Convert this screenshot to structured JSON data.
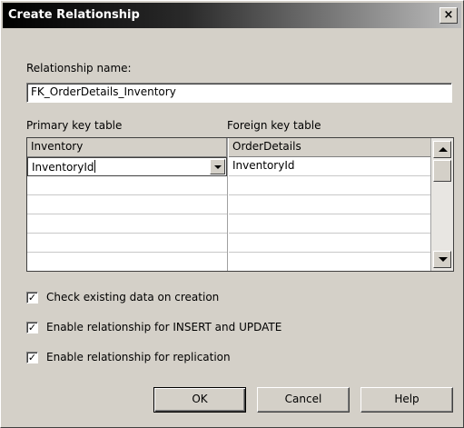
{
  "window": {
    "title": "Create Relationship",
    "close_label": "×"
  },
  "relationship_name": {
    "label": "Relationship name:",
    "value": "FK_OrderDetails_Inventory"
  },
  "grid": {
    "primary_label": "Primary key table",
    "foreign_label": "Foreign key table",
    "primary_table": "Inventory",
    "foreign_table": "OrderDetails",
    "rows": [
      {
        "primary": "InventoryId",
        "foreign": "InventoryId"
      },
      {
        "primary": "",
        "foreign": ""
      },
      {
        "primary": "",
        "foreign": ""
      },
      {
        "primary": "",
        "foreign": ""
      },
      {
        "primary": "",
        "foreign": ""
      },
      {
        "primary": "",
        "foreign": ""
      }
    ]
  },
  "options": {
    "check_existing": {
      "label": "Check existing data on creation",
      "checked": true
    },
    "enable_insert_update": {
      "label": "Enable relationship for INSERT and UPDATE",
      "checked": true
    },
    "enable_replication": {
      "label": "Enable relationship for replication",
      "checked": true
    }
  },
  "buttons": {
    "ok": "OK",
    "cancel": "Cancel",
    "help": "Help"
  },
  "checkmark": "✓"
}
